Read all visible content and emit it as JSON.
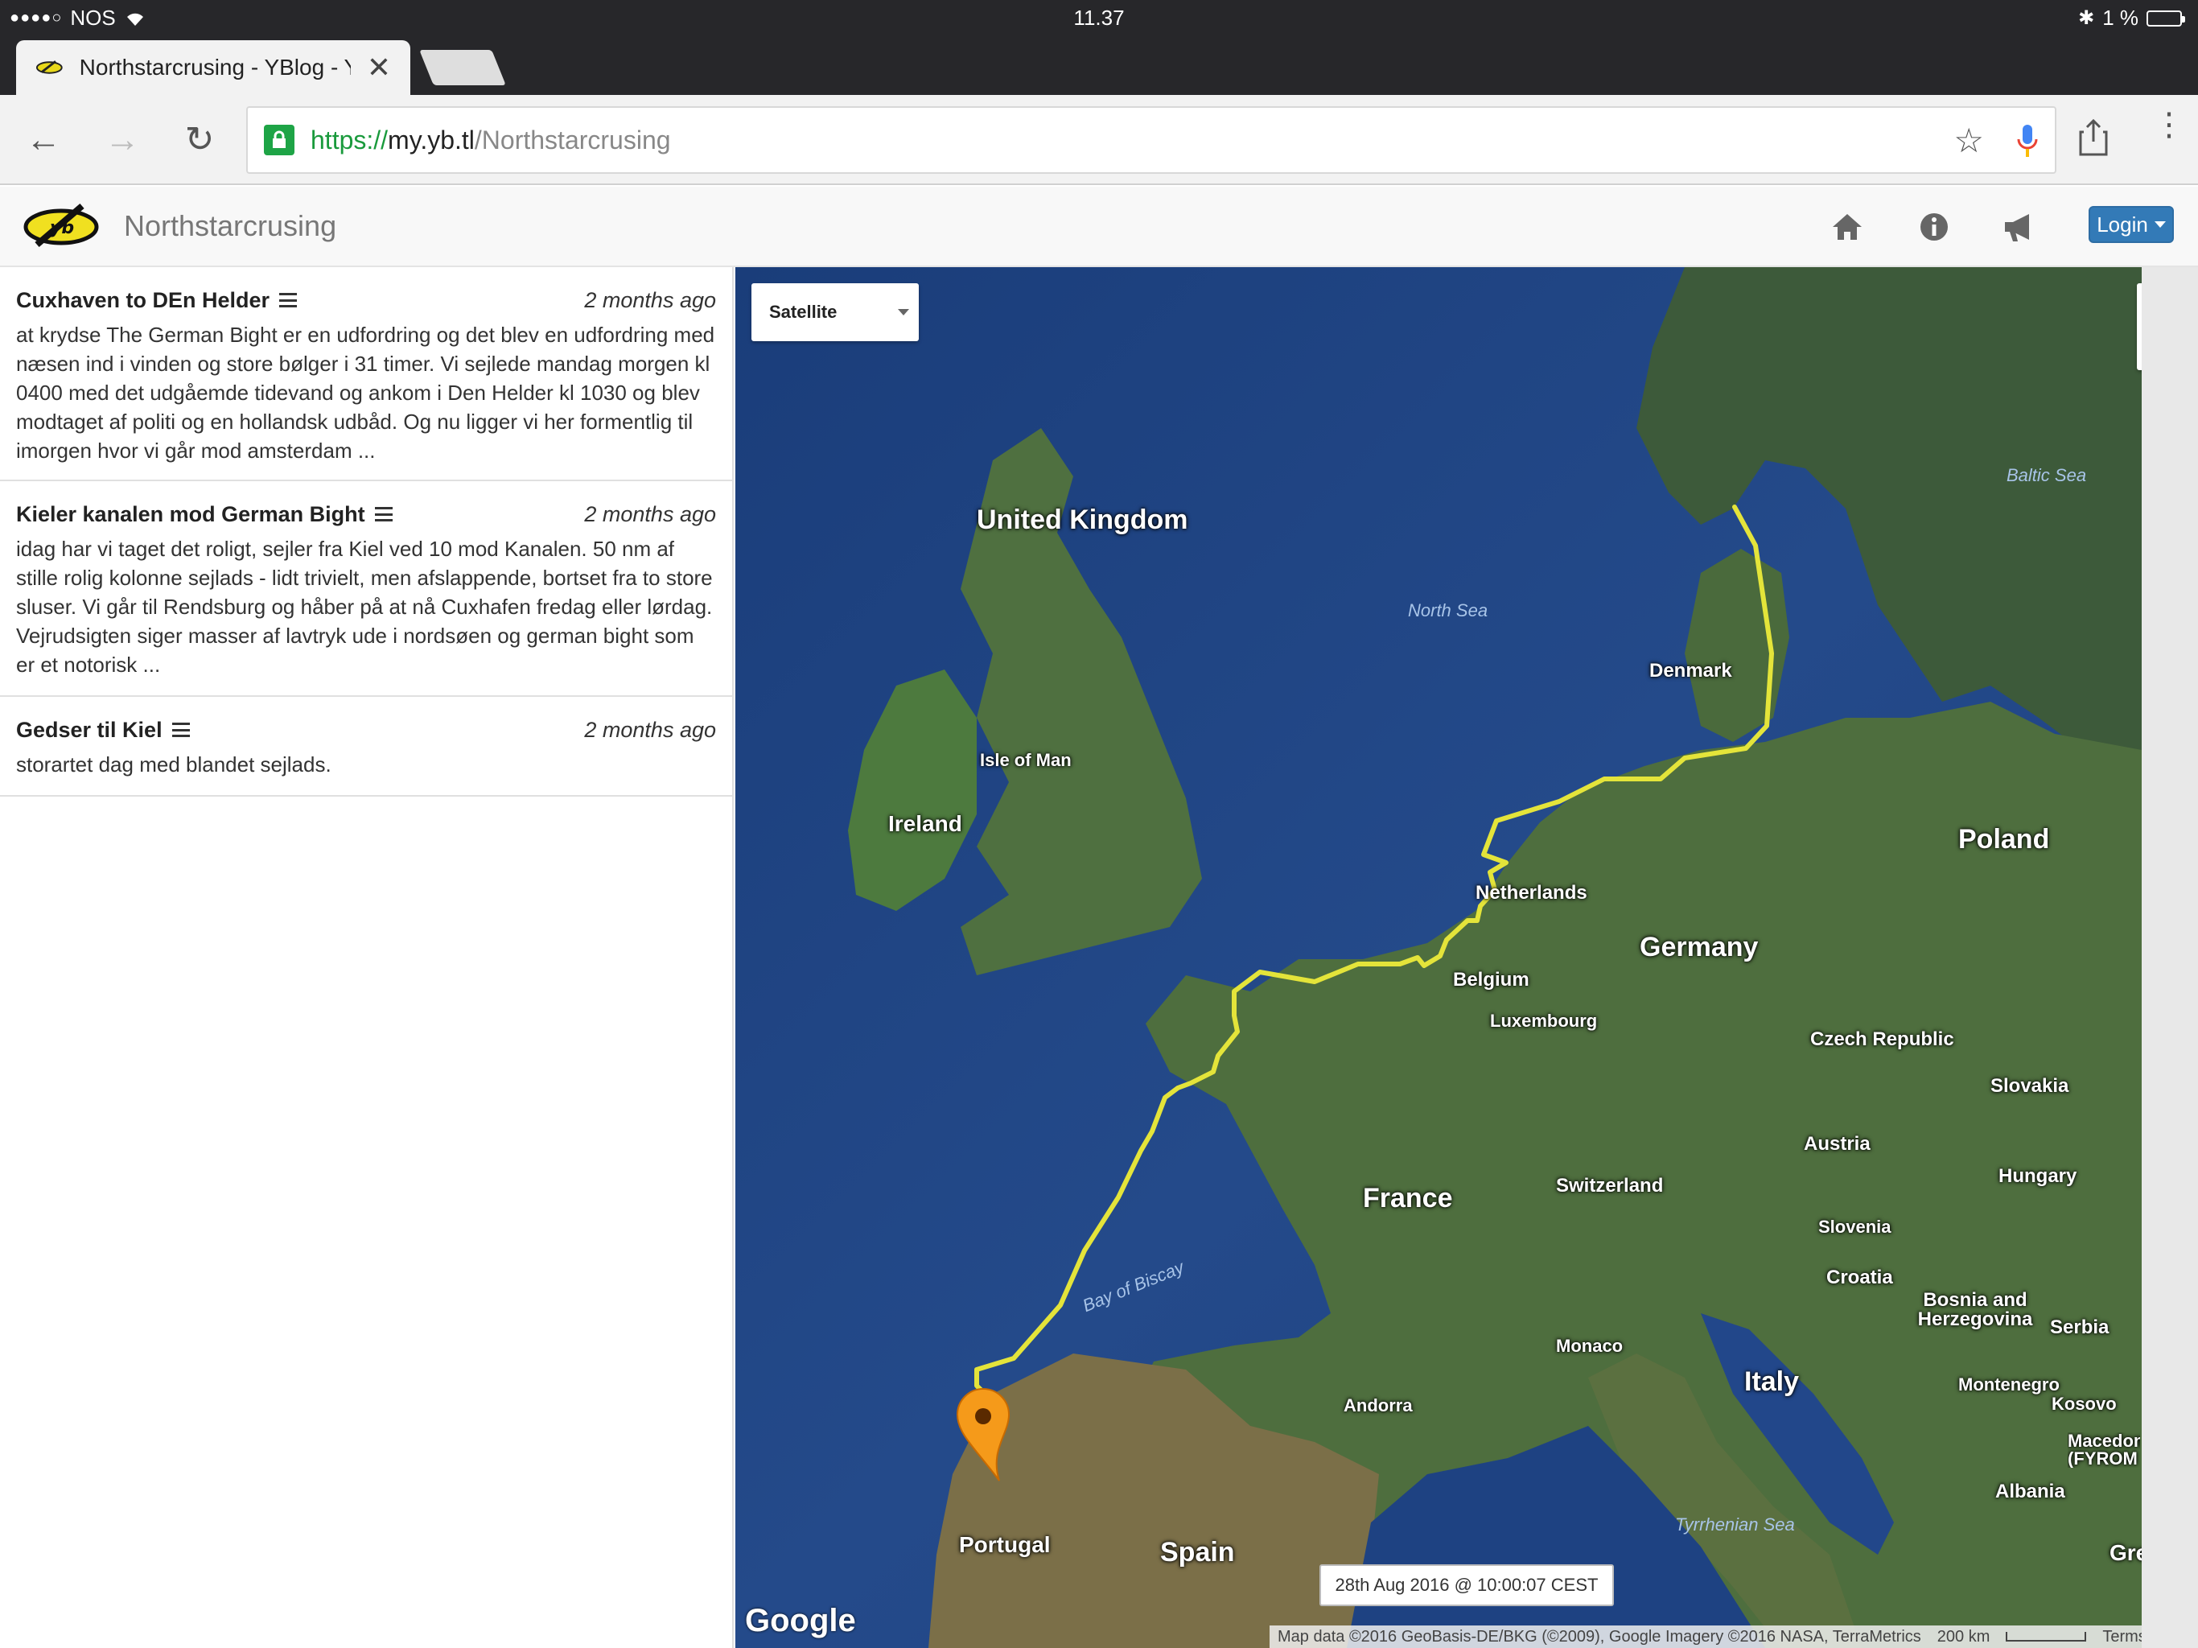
{
  "status_bar": {
    "carrier": "NOS",
    "time": "11.37",
    "battery": "1 %"
  },
  "tab": {
    "title": "Northstarcrusing - YBlog - Y",
    "close_icon": "close-icon"
  },
  "address_bar": {
    "scheme": "https://",
    "host": "my.yb.tl",
    "path": "/Northstarcrusing"
  },
  "site": {
    "title": "Northstarcrusing",
    "login_label": "Login",
    "accent_color": "#337ab7"
  },
  "posts": [
    {
      "title": "Cuxhaven to DEn Helder",
      "time": "2 months ago",
      "body": "at krydse The German Bight er en udfordring og det blev en udfordring med næsen ind i vinden og store bølger i 31 timer. Vi sejlede mandag morgen kl 0400 med det udgåemde tidevand og ankom i Den Helder kl 1030 og blev modtaget af politi og en hollandsk udbåd. Og nu ligger vi her formentlig til imorgen hvor vi går mod amsterdam ..."
    },
    {
      "title": "Kieler kanalen mod German Bight",
      "time": "2 months ago",
      "body": "idag har vi taget det roligt, sejler fra Kiel ved 10 mod Kanalen. 50 nm af stille rolig kolonne sejlads - lidt trivielt, men afslappende, bortset fra to store sluser. Vi går til Rendsburg og håber på at nå Cuxhafen fredag eller lørdag. Vejrudsigten siger masser af lavtryk ude i nordsøen og german bight som er et notorisk ..."
    },
    {
      "title": "Gedser til Kiel",
      "time": "2 months ago",
      "body": "storartet dag med blandet sejlads."
    }
  ],
  "map": {
    "type_label": "Satellite",
    "zoom_in": "+",
    "zoom_out": "−",
    "timestamp": "28th Aug 2016 @ 10:00:07 CEST",
    "google": "Google",
    "attribution": "Map data ©2016 GeoBasis-DE/BKG (©2009), Google Imagery ©2016 NASA, TerraMetrics",
    "scale": "200 km",
    "terms": "Terms of Use",
    "track_color": "#e4e43a",
    "countries": {
      "uk": "United Kingdom",
      "ireland": "Ireland",
      "isle_of_man": "Isle of Man",
      "denmark": "Denmark",
      "netherlands": "Netherlands",
      "belgium": "Belgium",
      "luxembourg": "Luxembourg",
      "germany": "Germany",
      "poland": "Poland",
      "czech": "Czech Republic",
      "slovakia": "Slovakia",
      "austria": "Austria",
      "hungary": "Hungary",
      "france": "France",
      "switzerland": "Switzerland",
      "slovenia": "Slovenia",
      "croatia": "Croatia",
      "bosnia": "Bosnia and Herzegovina",
      "serbia": "Serbia",
      "monaco": "Monaco",
      "andorra": "Andorra",
      "italy": "Italy",
      "montenegro": "Montenegro",
      "kosovo": "Kosovo",
      "macedonia": "Macedon (FYROM",
      "albania": "Albania",
      "portugal": "Portugal",
      "spain": "Spain",
      "greece": "Gre"
    },
    "waters": {
      "north_sea": "North Sea",
      "baltic": "Baltic Sea",
      "biscay": "Bay of Biscay",
      "tyrrhenian": "Tyrrhenian Sea"
    }
  }
}
